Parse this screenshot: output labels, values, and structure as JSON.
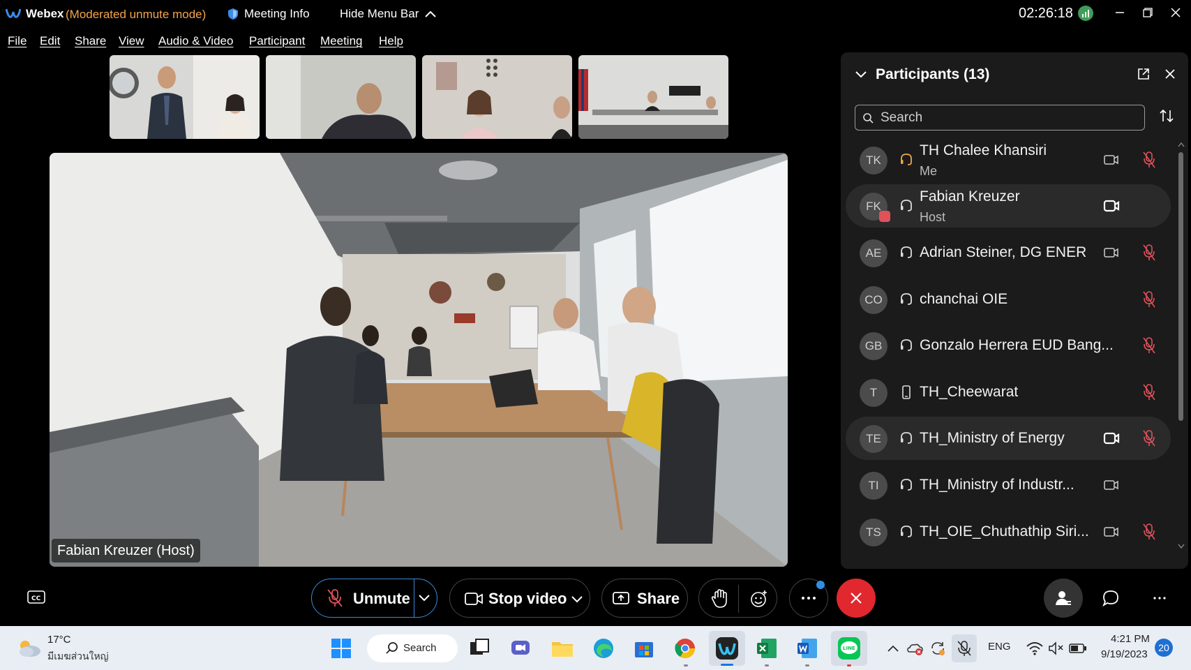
{
  "titlebar": {
    "app_name": "Webex",
    "mode": "(Moderated unmute mode)",
    "meeting_info": "Meeting Info",
    "hide_menu_bar": "Hide Menu Bar",
    "clock": "02:26:18"
  },
  "menu": [
    "File",
    "Edit",
    "Share",
    "View",
    "Audio & Video",
    "Participant",
    "Meeting",
    "Help"
  ],
  "main_video": {
    "label": "Fabian Kreuzer (Host)"
  },
  "participants": {
    "title": "Participants (13)",
    "search_placeholder": "Search",
    "items": [
      {
        "initials": "TK",
        "name": "TH Chalee Khansiri",
        "sub": "Me",
        "audio": "computer-audio-orange",
        "camera": "video-off",
        "muted": true
      },
      {
        "initials": "FK",
        "name": "Fabian Kreuzer",
        "sub": "Host",
        "audio": "computer-audio",
        "camera": "video-on",
        "muted": false
      },
      {
        "initials": "AE",
        "name": "Adrian Steiner, DG ENER",
        "sub": "",
        "audio": "computer-audio",
        "camera": "video-off",
        "muted": true
      },
      {
        "initials": "CO",
        "name": "chanchai OIE",
        "sub": "",
        "audio": "computer-audio",
        "camera": "",
        "muted": true
      },
      {
        "initials": "GB",
        "name": "Gonzalo Herrera EUD Bang...",
        "sub": "",
        "audio": "computer-audio",
        "camera": "",
        "muted": true
      },
      {
        "initials": "T",
        "name": "TH_Cheewarat",
        "sub": "",
        "audio": "phone",
        "camera": "",
        "muted": true
      },
      {
        "initials": "TE",
        "name": "TH_Ministry of Energy",
        "sub": "",
        "audio": "computer-audio",
        "camera": "video-on",
        "muted": true
      },
      {
        "initials": "TI",
        "name": "TH_Ministry of Industr...",
        "sub": "",
        "audio": "computer-audio",
        "camera": "video-off",
        "muted": false
      },
      {
        "initials": "TS",
        "name": "TH_OIE_Chuthathip Siri...",
        "sub": "",
        "audio": "computer-audio",
        "camera": "video-off",
        "muted": true
      }
    ]
  },
  "controls": {
    "unmute": "Unmute",
    "stop_video": "Stop video",
    "share": "Share"
  },
  "taskbar": {
    "temperature": "17°C",
    "weather": "มีเมฆส่วนใหญ่",
    "search": "Search",
    "language": "ENG",
    "time": "4:21 PM",
    "date": "9/19/2023",
    "notifications": "20"
  },
  "colors": {
    "mode_orange": "#f5a34a",
    "end_call_red": "#e0282e",
    "muted_red": "#e0525a",
    "accent_blue": "#3a8bd6"
  }
}
